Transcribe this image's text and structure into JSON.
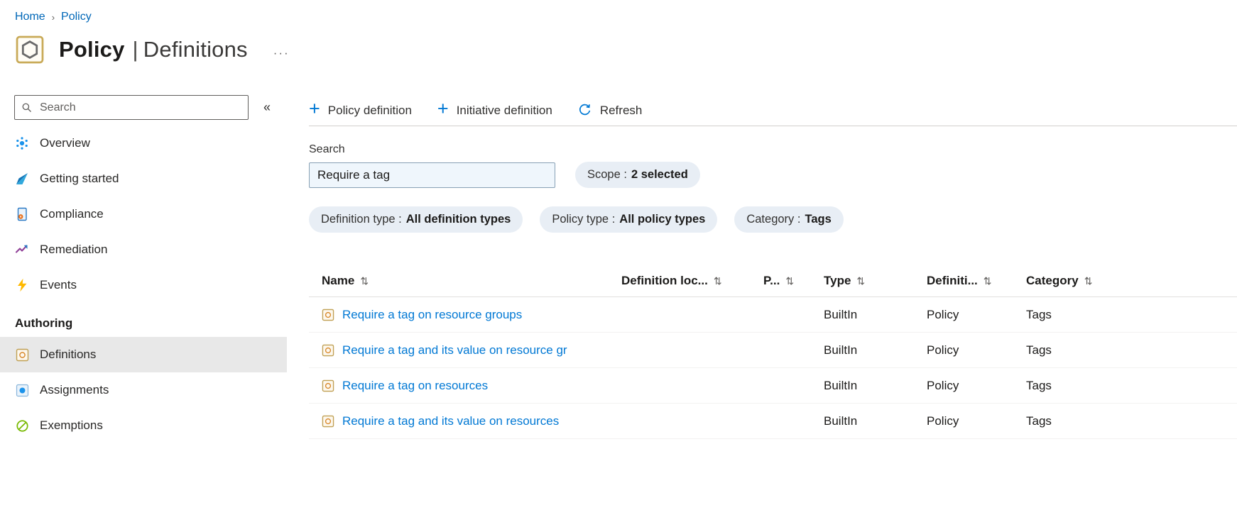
{
  "breadcrumb": {
    "home": "Home",
    "policy": "Policy",
    "separator": "›"
  },
  "header": {
    "title": "Policy",
    "divider": "|",
    "subtitle": "Definitions",
    "more_glyph": "···"
  },
  "sidebar": {
    "search_placeholder": "Search",
    "collapse_glyph": "«",
    "items": [
      {
        "label": "Overview"
      },
      {
        "label": "Getting started"
      },
      {
        "label": "Compliance"
      },
      {
        "label": "Remediation"
      },
      {
        "label": "Events"
      }
    ],
    "section_label": "Authoring",
    "authoring_items": [
      {
        "label": "Definitions"
      },
      {
        "label": "Assignments"
      },
      {
        "label": "Exemptions"
      }
    ]
  },
  "toolbar": {
    "plus_glyph": "+",
    "policy_definition": "Policy definition",
    "initiative_definition": "Initiative definition",
    "refresh": "Refresh"
  },
  "filter": {
    "search_label": "Search",
    "search_value": "Require a tag",
    "pills": [
      {
        "label": "Scope :",
        "value": "2 selected"
      },
      {
        "label": "Definition type :",
        "value": "All definition types"
      },
      {
        "label": "Policy type :",
        "value": "All policy types"
      },
      {
        "label": "Category :",
        "value": "Tags"
      }
    ]
  },
  "table": {
    "sort_glyph": "⇅",
    "columns": [
      {
        "label": "Name"
      },
      {
        "label": "Definition loc..."
      },
      {
        "label": "P..."
      },
      {
        "label": "Type"
      },
      {
        "label": "Definiti..."
      },
      {
        "label": "Category"
      }
    ],
    "rows": [
      {
        "name": "Require a tag on resource groups",
        "type": "BuiltIn",
        "definition_type": "Policy",
        "category": "Tags"
      },
      {
        "name": "Require a tag and its value on resource gr",
        "type": "BuiltIn",
        "definition_type": "Policy",
        "category": "Tags"
      },
      {
        "name": "Require a tag on resources",
        "type": "BuiltIn",
        "definition_type": "Policy",
        "category": "Tags"
      },
      {
        "name": "Require a tag and its value on resources",
        "type": "BuiltIn",
        "definition_type": "Policy",
        "category": "Tags"
      }
    ]
  },
  "colors": {
    "accent": "#0078d4",
    "link": "#0067b8",
    "pill_bg": "#e8eef5",
    "selected_bg": "#e8e8e8"
  }
}
